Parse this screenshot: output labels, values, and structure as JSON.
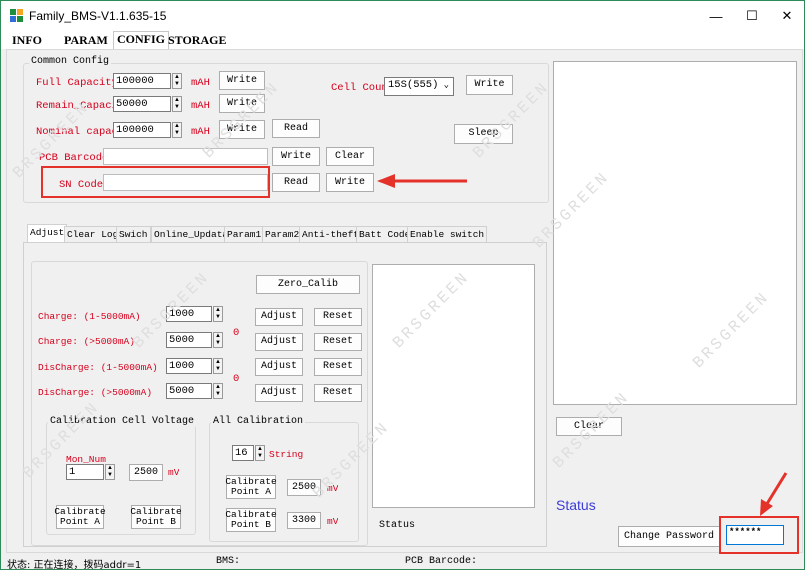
{
  "window": {
    "title": "Family_BMS-V1.1.635-15",
    "minimize": "—",
    "maximize": "☐",
    "close": "✕"
  },
  "menu": {
    "items": [
      "INFO",
      "PARAM",
      "CONFIG",
      "STORAGE"
    ]
  },
  "common_config": {
    "legend": "Common Config",
    "full_capacity": {
      "label": "Full Capacity",
      "value": "100000",
      "unit": "mAH",
      "write": "Write"
    },
    "remain_capacity": {
      "label": "Remain_Capacit",
      "value": "50000",
      "unit": "mAH",
      "write": "Write"
    },
    "nominal_capacity": {
      "label": "Nominal capaci",
      "value": "100000",
      "unit": "mAH",
      "write": "Write",
      "read": "Read"
    },
    "cell_count": {
      "label": "Cell Count",
      "value": "15S(555)",
      "write": "Write"
    },
    "sleep": "Sleep",
    "pcb_barcode": {
      "label": "PCB Barcode",
      "value": "",
      "write": "Write",
      "clear": "Clear"
    },
    "sn_code": {
      "label": "SN Code",
      "value": "",
      "read": "Read",
      "write": "Write"
    }
  },
  "tabs": [
    "Adjust",
    "Clear Log",
    "Swich",
    "Online_Updata",
    "Param1",
    "Param2",
    "Anti-theft",
    "Batt Code",
    "Enable switch"
  ],
  "adjust": {
    "zero_calib": "Zero_Calib",
    "rows": [
      {
        "label": "Charge: (1-5000mA)",
        "value": "1000",
        "adjust": "Adjust",
        "reset": "Reset"
      },
      {
        "label": "Charge: (>5000mA)",
        "value": "5000",
        "adjust": "Adjust",
        "reset": "Reset"
      },
      {
        "label": "DisCharge: (1-5000mA)",
        "value": "1000",
        "adjust": "Adjust",
        "reset": "Reset"
      },
      {
        "label": "DisCharge: (>5000mA)",
        "value": "5000",
        "adjust": "Adjust",
        "reset": "Reset"
      }
    ],
    "charge_zero": "0",
    "discharge_zero": "0",
    "cell_voltage": {
      "legend": "Calibration Cell Voltage",
      "mon_num_label": "Mon_Num",
      "mon_num_value": "1",
      "voltage_value": "2500",
      "unit": "mV",
      "calib_a": "Calibrate Point A",
      "calib_b": "Calibrate Point B"
    },
    "all_calibration": {
      "legend": "All Calibration",
      "string_value": "16",
      "string_label": "String",
      "calib_a": "Calibrate Point A",
      "value_a": "2500",
      "unit_a": "mV",
      "calib_b": "Calibrate Point B",
      "value_b": "3300",
      "unit_b": "mV"
    },
    "status_label": "Status"
  },
  "right_panel": {
    "clear": "Clear",
    "status": "Status",
    "change_password": "Change Password",
    "password_value": "******"
  },
  "statusbar": {
    "state": "状态: 正在连接，拨码addr=1",
    "bms": "BMS:",
    "pcb_barcode": "PCB Barcode:"
  },
  "watermark": "BRSGREEN",
  "colors": {
    "label_red": "#d6001c",
    "highlight_red": "#e4322b",
    "status_blue": "#3b3bd6",
    "window_border": "#2e8b57"
  }
}
